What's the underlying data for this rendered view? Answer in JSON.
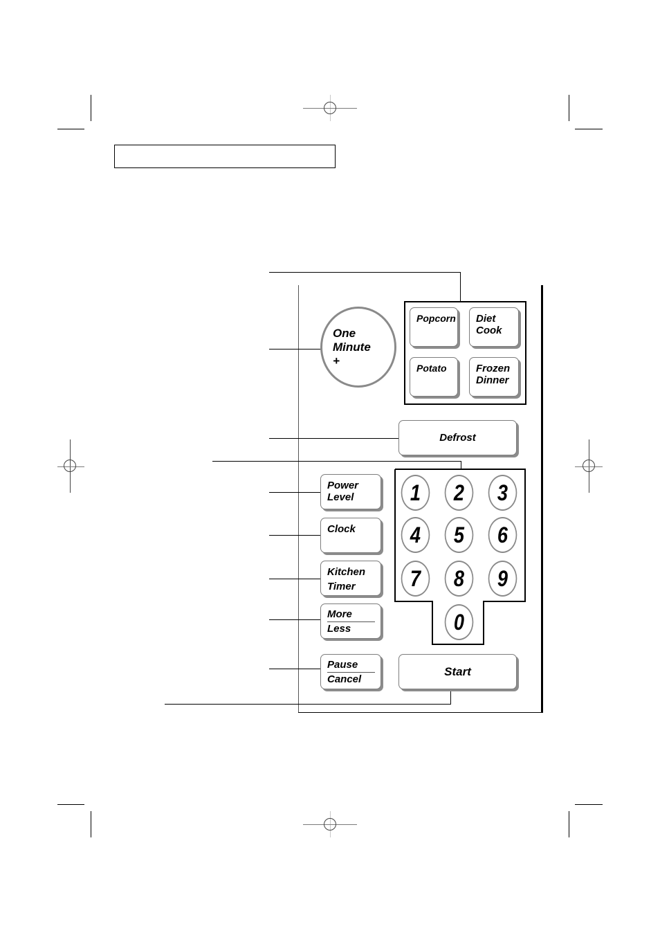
{
  "title_box": {
    "text": ""
  },
  "control_panel": {
    "one_minute_button": {
      "line1": "One",
      "line2": "Minute",
      "line3": "+"
    },
    "auto_cook_buttons": [
      {
        "id": "popcorn",
        "line1": "Popcorn",
        "line2": ""
      },
      {
        "id": "diet-cook",
        "line1": "Diet",
        "line2": "Cook"
      },
      {
        "id": "potato",
        "line1": "Potato",
        "line2": ""
      },
      {
        "id": "frozen-dinner",
        "line1": "Frozen",
        "line2": "Dinner"
      }
    ],
    "defrost_button": {
      "label": "Defrost"
    },
    "power_level_button": {
      "line1": "Power",
      "line2": "Level"
    },
    "clock_button": {
      "label": "Clock"
    },
    "kitchen_timer_button": {
      "line1": "Kitchen",
      "line2": "Timer"
    },
    "more_less_button": {
      "top": "More",
      "bottom": "Less"
    },
    "pause_cancel_button": {
      "top": "Pause",
      "bottom": "Cancel"
    },
    "start_button": {
      "label": "Start"
    },
    "number_pad": [
      "1",
      "2",
      "3",
      "4",
      "5",
      "6",
      "7",
      "8",
      "9",
      "0"
    ]
  },
  "colors": {
    "button_border": "#7d7d7d",
    "button_shadow": "#8c8c8c",
    "line": "#000000"
  }
}
